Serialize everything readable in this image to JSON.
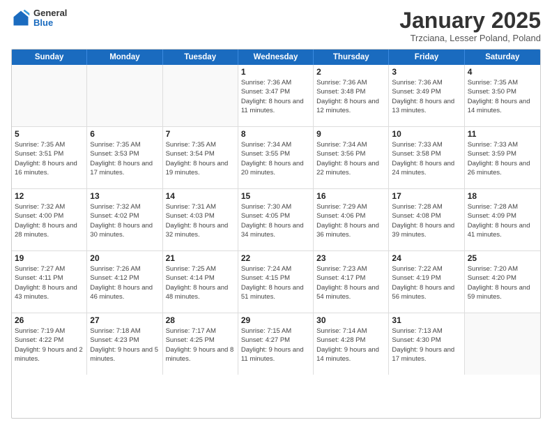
{
  "header": {
    "logo": {
      "general": "General",
      "blue": "Blue"
    },
    "title": "January 2025",
    "location": "Trzciana, Lesser Poland, Poland"
  },
  "days_of_week": [
    "Sunday",
    "Monday",
    "Tuesday",
    "Wednesday",
    "Thursday",
    "Friday",
    "Saturday"
  ],
  "weeks": [
    [
      {
        "day": null
      },
      {
        "day": null
      },
      {
        "day": null
      },
      {
        "day": "1",
        "sunrise": "Sunrise: 7:36 AM",
        "sunset": "Sunset: 3:47 PM",
        "daylight": "Daylight: 8 hours and 11 minutes."
      },
      {
        "day": "2",
        "sunrise": "Sunrise: 7:36 AM",
        "sunset": "Sunset: 3:48 PM",
        "daylight": "Daylight: 8 hours and 12 minutes."
      },
      {
        "day": "3",
        "sunrise": "Sunrise: 7:36 AM",
        "sunset": "Sunset: 3:49 PM",
        "daylight": "Daylight: 8 hours and 13 minutes."
      },
      {
        "day": "4",
        "sunrise": "Sunrise: 7:35 AM",
        "sunset": "Sunset: 3:50 PM",
        "daylight": "Daylight: 8 hours and 14 minutes."
      }
    ],
    [
      {
        "day": "5",
        "sunrise": "Sunrise: 7:35 AM",
        "sunset": "Sunset: 3:51 PM",
        "daylight": "Daylight: 8 hours and 16 minutes."
      },
      {
        "day": "6",
        "sunrise": "Sunrise: 7:35 AM",
        "sunset": "Sunset: 3:53 PM",
        "daylight": "Daylight: 8 hours and 17 minutes."
      },
      {
        "day": "7",
        "sunrise": "Sunrise: 7:35 AM",
        "sunset": "Sunset: 3:54 PM",
        "daylight": "Daylight: 8 hours and 19 minutes."
      },
      {
        "day": "8",
        "sunrise": "Sunrise: 7:34 AM",
        "sunset": "Sunset: 3:55 PM",
        "daylight": "Daylight: 8 hours and 20 minutes."
      },
      {
        "day": "9",
        "sunrise": "Sunrise: 7:34 AM",
        "sunset": "Sunset: 3:56 PM",
        "daylight": "Daylight: 8 hours and 22 minutes."
      },
      {
        "day": "10",
        "sunrise": "Sunrise: 7:33 AM",
        "sunset": "Sunset: 3:58 PM",
        "daylight": "Daylight: 8 hours and 24 minutes."
      },
      {
        "day": "11",
        "sunrise": "Sunrise: 7:33 AM",
        "sunset": "Sunset: 3:59 PM",
        "daylight": "Daylight: 8 hours and 26 minutes."
      }
    ],
    [
      {
        "day": "12",
        "sunrise": "Sunrise: 7:32 AM",
        "sunset": "Sunset: 4:00 PM",
        "daylight": "Daylight: 8 hours and 28 minutes."
      },
      {
        "day": "13",
        "sunrise": "Sunrise: 7:32 AM",
        "sunset": "Sunset: 4:02 PM",
        "daylight": "Daylight: 8 hours and 30 minutes."
      },
      {
        "day": "14",
        "sunrise": "Sunrise: 7:31 AM",
        "sunset": "Sunset: 4:03 PM",
        "daylight": "Daylight: 8 hours and 32 minutes."
      },
      {
        "day": "15",
        "sunrise": "Sunrise: 7:30 AM",
        "sunset": "Sunset: 4:05 PM",
        "daylight": "Daylight: 8 hours and 34 minutes."
      },
      {
        "day": "16",
        "sunrise": "Sunrise: 7:29 AM",
        "sunset": "Sunset: 4:06 PM",
        "daylight": "Daylight: 8 hours and 36 minutes."
      },
      {
        "day": "17",
        "sunrise": "Sunrise: 7:28 AM",
        "sunset": "Sunset: 4:08 PM",
        "daylight": "Daylight: 8 hours and 39 minutes."
      },
      {
        "day": "18",
        "sunrise": "Sunrise: 7:28 AM",
        "sunset": "Sunset: 4:09 PM",
        "daylight": "Daylight: 8 hours and 41 minutes."
      }
    ],
    [
      {
        "day": "19",
        "sunrise": "Sunrise: 7:27 AM",
        "sunset": "Sunset: 4:11 PM",
        "daylight": "Daylight: 8 hours and 43 minutes."
      },
      {
        "day": "20",
        "sunrise": "Sunrise: 7:26 AM",
        "sunset": "Sunset: 4:12 PM",
        "daylight": "Daylight: 8 hours and 46 minutes."
      },
      {
        "day": "21",
        "sunrise": "Sunrise: 7:25 AM",
        "sunset": "Sunset: 4:14 PM",
        "daylight": "Daylight: 8 hours and 48 minutes."
      },
      {
        "day": "22",
        "sunrise": "Sunrise: 7:24 AM",
        "sunset": "Sunset: 4:15 PM",
        "daylight": "Daylight: 8 hours and 51 minutes."
      },
      {
        "day": "23",
        "sunrise": "Sunrise: 7:23 AM",
        "sunset": "Sunset: 4:17 PM",
        "daylight": "Daylight: 8 hours and 54 minutes."
      },
      {
        "day": "24",
        "sunrise": "Sunrise: 7:22 AM",
        "sunset": "Sunset: 4:19 PM",
        "daylight": "Daylight: 8 hours and 56 minutes."
      },
      {
        "day": "25",
        "sunrise": "Sunrise: 7:20 AM",
        "sunset": "Sunset: 4:20 PM",
        "daylight": "Daylight: 8 hours and 59 minutes."
      }
    ],
    [
      {
        "day": "26",
        "sunrise": "Sunrise: 7:19 AM",
        "sunset": "Sunset: 4:22 PM",
        "daylight": "Daylight: 9 hours and 2 minutes."
      },
      {
        "day": "27",
        "sunrise": "Sunrise: 7:18 AM",
        "sunset": "Sunset: 4:23 PM",
        "daylight": "Daylight: 9 hours and 5 minutes."
      },
      {
        "day": "28",
        "sunrise": "Sunrise: 7:17 AM",
        "sunset": "Sunset: 4:25 PM",
        "daylight": "Daylight: 9 hours and 8 minutes."
      },
      {
        "day": "29",
        "sunrise": "Sunrise: 7:15 AM",
        "sunset": "Sunset: 4:27 PM",
        "daylight": "Daylight: 9 hours and 11 minutes."
      },
      {
        "day": "30",
        "sunrise": "Sunrise: 7:14 AM",
        "sunset": "Sunset: 4:28 PM",
        "daylight": "Daylight: 9 hours and 14 minutes."
      },
      {
        "day": "31",
        "sunrise": "Sunrise: 7:13 AM",
        "sunset": "Sunset: 4:30 PM",
        "daylight": "Daylight: 9 hours and 17 minutes."
      },
      {
        "day": null
      }
    ]
  ]
}
